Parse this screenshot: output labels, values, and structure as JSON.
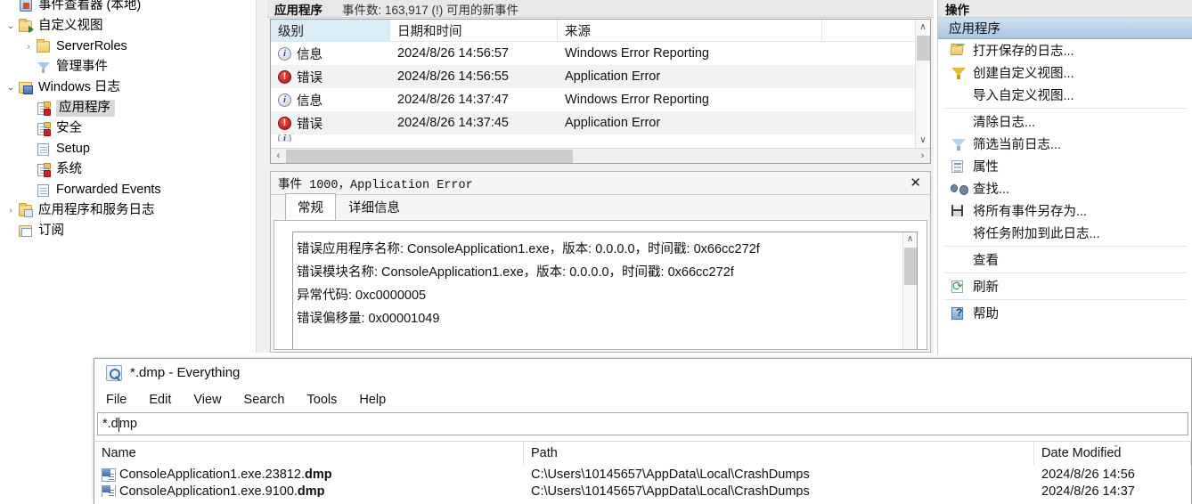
{
  "event_viewer": {
    "tree": {
      "items": [
        {
          "label": "事件查看器 (本地)",
          "icon": "app-root-icon",
          "indent": 0,
          "twisty": "",
          "selected": false
        },
        {
          "label": "自定义视图",
          "icon": "folder-arrow-icon",
          "indent": 0,
          "twisty": "⌄",
          "selected": false
        },
        {
          "label": "ServerRoles",
          "icon": "folder-icon",
          "indent": 1,
          "twisty": "›",
          "selected": false
        },
        {
          "label": "管理事件",
          "icon": "funnel-icon",
          "indent": 1,
          "twisty": "",
          "selected": false
        },
        {
          "label": "Windows 日志",
          "icon": "computer-log-icon",
          "indent": 0,
          "twisty": "⌄",
          "selected": false
        },
        {
          "label": "应用程序",
          "icon": "log-badge-icon",
          "indent": 1,
          "twisty": "",
          "selected": true
        },
        {
          "label": "安全",
          "icon": "log-badge-icon",
          "indent": 1,
          "twisty": "",
          "selected": false
        },
        {
          "label": "Setup",
          "icon": "log-icon",
          "indent": 1,
          "twisty": "",
          "selected": false
        },
        {
          "label": "系统",
          "icon": "log-badge-icon",
          "indent": 1,
          "twisty": "",
          "selected": false
        },
        {
          "label": "Forwarded Events",
          "icon": "log-icon",
          "indent": 1,
          "twisty": "",
          "selected": false
        },
        {
          "label": "应用程序和服务日志",
          "icon": "folder-sub-icon",
          "indent": 0,
          "twisty": "›",
          "selected": false
        },
        {
          "label": "订阅",
          "icon": "subscriptions-icon",
          "indent": 0,
          "twisty": "",
          "selected": false
        }
      ]
    },
    "list": {
      "header_title": "应用程序",
      "header_count": "事件数: 163,917 (!) 可用的新事件",
      "columns": [
        "级别",
        "日期和时间",
        "来源"
      ],
      "rows": [
        {
          "level": "信息",
          "level_icon": "info-icon",
          "datetime": "2024/8/26 14:56:57",
          "source": "Windows Error Reporting"
        },
        {
          "level": "错误",
          "level_icon": "error-icon",
          "datetime": "2024/8/26 14:56:55",
          "source": "Application Error"
        },
        {
          "level": "信息",
          "level_icon": "info-icon",
          "datetime": "2024/8/26 14:37:47",
          "source": "Windows Error Reporting"
        },
        {
          "level": "错误",
          "level_icon": "error-icon",
          "datetime": "2024/8/26 14:37:45",
          "source": "Application Error"
        }
      ],
      "hscroll_left_arrow": "‹",
      "hscroll_right_arrow": "›",
      "vscroll_up_arrow": "∧",
      "vscroll_down_arrow": "∨"
    },
    "detail": {
      "title": "事件 1000，Application Error",
      "close_label": "✕",
      "tabs": [
        {
          "label": "常规",
          "active": true
        },
        {
          "label": "详细信息",
          "active": false
        }
      ],
      "general_lines": [
        "错误应用程序名称: ConsoleApplication1.exe，版本: 0.0.0.0，时间戳: 0x66cc272f",
        "错误模块名称: ConsoleApplication1.exe，版本: 0.0.0.0，时间戳: 0x66cc272f",
        "异常代码: 0xc0000005",
        "错误偏移量: 0x00001049"
      ],
      "vscroll_up_arrow": "∧"
    },
    "actions": {
      "header": "操作",
      "subheader": "应用程序",
      "items": [
        {
          "label": "打开保存的日志...",
          "icon": "open-saved-log-icon",
          "sep_after": false
        },
        {
          "label": "创建自定义视图...",
          "icon": "create-custom-view-icon",
          "sep_after": false
        },
        {
          "label": "导入自定义视图...",
          "icon": "",
          "sep_after": true
        },
        {
          "label": "清除日志...",
          "icon": "",
          "sep_after": false
        },
        {
          "label": "筛选当前日志...",
          "icon": "filter-icon",
          "sep_after": false
        },
        {
          "label": "属性",
          "icon": "properties-icon",
          "sep_after": false
        },
        {
          "label": "查找...",
          "icon": "find-binoculars-icon",
          "sep_after": false
        },
        {
          "label": "将所有事件另存为...",
          "icon": "save-icon",
          "sep_after": false
        },
        {
          "label": "将任务附加到此日志...",
          "icon": "",
          "sep_after": true
        },
        {
          "label": "查看",
          "icon": "",
          "sep_after": true
        },
        {
          "label": "刷新",
          "icon": "refresh-icon",
          "sep_after": true
        },
        {
          "label": "帮助",
          "icon": "help-icon",
          "sep_after": false
        }
      ]
    }
  },
  "everything": {
    "title": "*.dmp - Everything",
    "title_icon": "everything-magnifier-icon",
    "menus": [
      "File",
      "Edit",
      "View",
      "Search",
      "Tools",
      "Help"
    ],
    "search_value": "*.dmp",
    "columns": [
      {
        "label": "Name",
        "sort": ""
      },
      {
        "label": "Path",
        "sort": ""
      },
      {
        "label": "Date Modified",
        "sort": "⌄"
      }
    ],
    "rows": [
      {
        "name_plain": "ConsoleApplication1.exe.23812.",
        "name_bold": "dmp",
        "path": "C:\\Users\\10145657\\AppData\\Local\\CrashDumps",
        "date": "2024/8/26 14:56"
      },
      {
        "name_plain": "ConsoleApplication1.exe.9100.",
        "name_bold": "dmp",
        "path": "C:\\Users\\10145657\\AppData\\Local\\CrashDumps",
        "date": "2024/8/26 14:37"
      }
    ]
  }
}
